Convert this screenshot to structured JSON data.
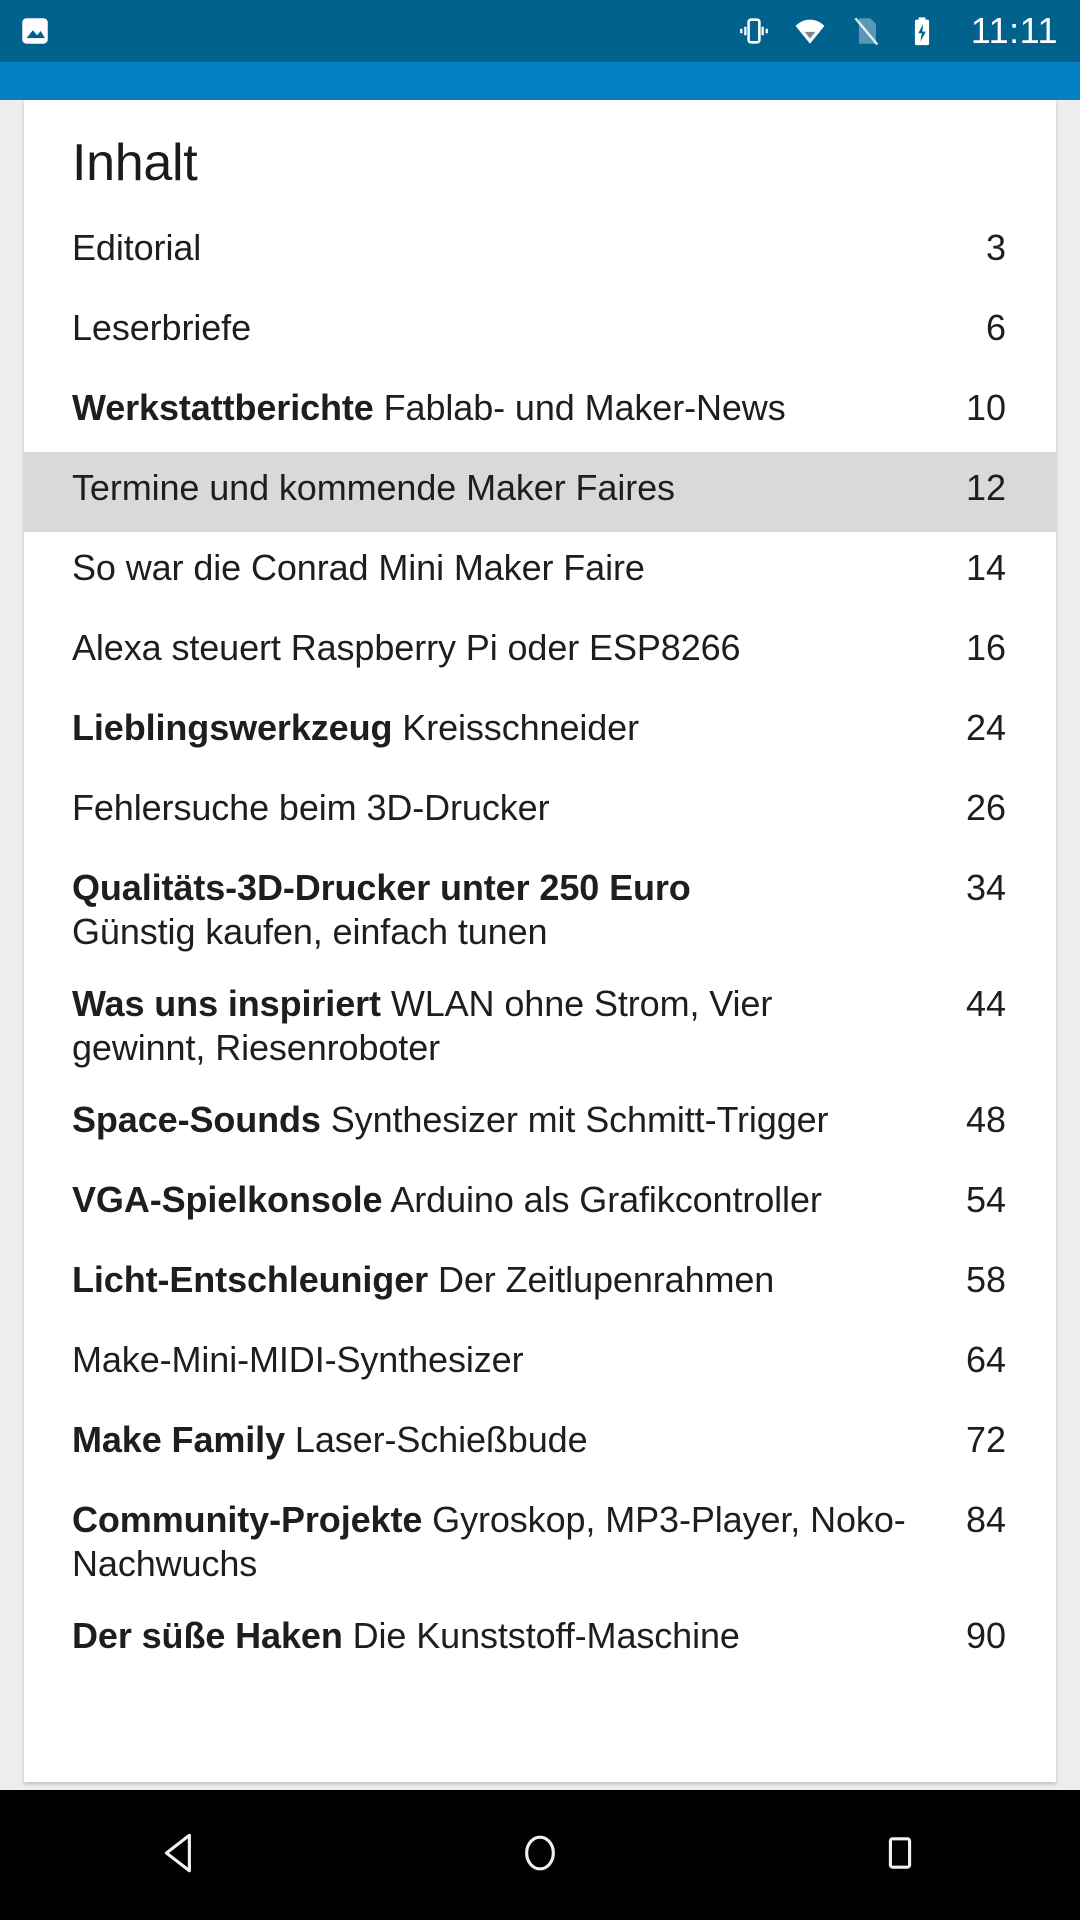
{
  "status_bar": {
    "notification_icon": "image-icon",
    "icons": [
      "vibrate-icon",
      "wifi-icon",
      "no-sim-icon",
      "battery-charging-icon"
    ],
    "clock": "11:11",
    "bar_color": "#01628E",
    "toolbar_color": "#0580C4"
  },
  "page": {
    "title": "Inhalt",
    "highlight_color": "#D9D9D9"
  },
  "toc": [
    {
      "bold": "",
      "rest": "Editorial",
      "sub": "",
      "page": "3",
      "highlight": false
    },
    {
      "bold": "",
      "rest": "Leserbriefe",
      "sub": "",
      "page": "6",
      "highlight": false
    },
    {
      "bold": "Werkstattberichte",
      "rest": " Fablab- und Maker-News",
      "sub": "",
      "page": "10",
      "highlight": false
    },
    {
      "bold": "",
      "rest": "Termine und kommende Maker Faires",
      "sub": "",
      "page": "12",
      "highlight": true
    },
    {
      "bold": "",
      "rest": "So war die Conrad Mini Maker Faire",
      "sub": "",
      "page": "14",
      "highlight": false
    },
    {
      "bold": "",
      "rest": "Alexa steuert Raspberry Pi oder ESP8266",
      "sub": "",
      "page": "16",
      "highlight": false
    },
    {
      "bold": "Lieblingswerkzeug",
      "rest": " Kreisschneider",
      "sub": "",
      "page": "24",
      "highlight": false
    },
    {
      "bold": "",
      "rest": "Fehlersuche beim 3D-Drucker",
      "sub": "",
      "page": "26",
      "highlight": false
    },
    {
      "bold": "Qualitäts-3D-Drucker unter 250 Euro",
      "rest": "",
      "sub": "Günstig kaufen, einfach tunen",
      "page": "34",
      "highlight": false
    },
    {
      "bold": "Was uns inspiriert",
      "rest": " WLAN ohne Strom, Vier gewinnt, Riesenroboter",
      "sub": "",
      "page": "44",
      "highlight": false
    },
    {
      "bold": "Space-Sounds",
      "rest": " Synthesizer mit Schmitt-Trigger",
      "sub": "",
      "page": "48",
      "highlight": false
    },
    {
      "bold": "VGA-Spielkonsole",
      "rest": " Arduino als Grafikcontroller",
      "sub": "",
      "page": "54",
      "highlight": false
    },
    {
      "bold": "Licht-Entschleuniger",
      "rest": " Der Zeitlupenrahmen",
      "sub": "",
      "page": "58",
      "highlight": false
    },
    {
      "bold": "",
      "rest": "Make-Mini-MIDI-Synthesizer",
      "sub": "",
      "page": "64",
      "highlight": false
    },
    {
      "bold": "Make Family",
      "rest": " Laser-Schießbude",
      "sub": "",
      "page": "72",
      "highlight": false
    },
    {
      "bold": "Community-Projekte",
      "rest": " Gyroskop, MP3-Player, Noko-Nachwuchs",
      "sub": "",
      "page": "84",
      "highlight": false
    },
    {
      "bold": "Der süße Haken",
      "rest": " Die Kunststoff-Maschine",
      "sub": "",
      "page": "90",
      "highlight": false
    }
  ],
  "nav_bar": {
    "back": "back-triangle-icon",
    "home": "home-circle-icon",
    "recents": "recents-square-icon"
  }
}
